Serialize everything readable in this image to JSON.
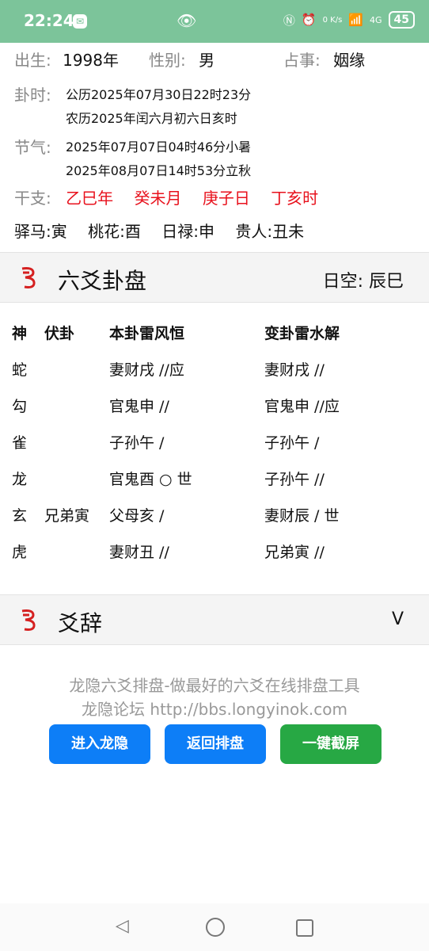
{
  "status_bar": {
    "time": "22:24",
    "battery": "45",
    "net_speed": "0 K/s",
    "network": "4G"
  },
  "info": {
    "birth_label": "出生:",
    "birth_value": "1998年",
    "gender_label": "性别:",
    "gender_value": "男",
    "matter_label": "占事:",
    "matter_value": "姻缘",
    "time_label": "卦时:",
    "time_solar": "公历2025年07月30日22时23分",
    "time_lunar": "农历2025年闰六月初六日亥时",
    "solar_term_label": "节气:",
    "solar_term_1": "2025年07月07日04时46分小暑",
    "solar_term_2": "2025年08月07日14时53分立秋",
    "ganzhi_label": "干支:",
    "ganzhi_year": "乙巳年",
    "ganzhi_month": "癸未月",
    "ganzhi_day": "庚子日",
    "ganzhi_hour": "丁亥时",
    "yima": "驿马:寅",
    "taohua": "桃花:酉",
    "rilu": "日禄:申",
    "guiren": "贵人:丑未"
  },
  "gua_section": {
    "title": "六爻卦盘",
    "kong": "日空:  辰巳"
  },
  "gua_table": {
    "headers": {
      "shen": "神",
      "fu": "伏卦",
      "ben": "本卦雷风恒",
      "bian": "变卦雷水解"
    },
    "rows": [
      {
        "shen": "蛇",
        "fu": "",
        "ben": "妻财戌 //应",
        "bian": "妻财戌 //"
      },
      {
        "shen": "勾",
        "fu": "",
        "ben": "官鬼申 //",
        "bian": "官鬼申 //应"
      },
      {
        "shen": "雀",
        "fu": "",
        "ben": "子孙午  /",
        "bian": "子孙午  /"
      },
      {
        "shen": "龙",
        "fu": "",
        "ben": "官鬼酉 ○ 世",
        "bian": "子孙午 //"
      },
      {
        "shen": "玄",
        "fu": "兄弟寅",
        "ben": "父母亥  /",
        "bian": "妻财辰  / 世"
      },
      {
        "shen": "虎",
        "fu": "",
        "ben": "妻财丑 //",
        "bian": "兄弟寅 //"
      }
    ]
  },
  "yaoci_section": {
    "title": "爻辞",
    "toggle": "V"
  },
  "footer": {
    "line1": "龙隐六爻排盘-做最好的六爻在线排盘工具",
    "line2": "龙隐论坛 http://bbs.longyinok.com",
    "btn_enter": "进入龙隐",
    "btn_back": "返回排盘",
    "btn_screenshot": "一键截屏"
  },
  "colors": {
    "status_bar": "#7cc49a",
    "ganzhi": "#e8121d",
    "btn_blue": "#0d7ef7",
    "btn_green": "#27a844"
  }
}
